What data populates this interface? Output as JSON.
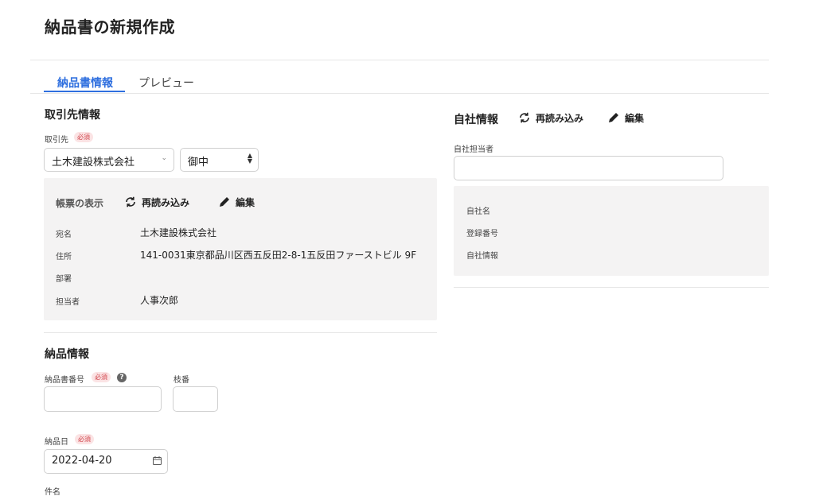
{
  "page": {
    "title": "納品書の新規作成"
  },
  "tabs": [
    {
      "label": "納品書情報",
      "active": true
    },
    {
      "label": "プレビュー",
      "active": false
    }
  ],
  "client": {
    "section_title": "取引先情報",
    "label": "取引先",
    "required": "必須",
    "selected": "土木建設株式会社",
    "honorific": "御中"
  },
  "display": {
    "title": "帳票の表示",
    "reload_label": "再読み込み",
    "edit_label": "編集",
    "rows": [
      {
        "label": "宛名",
        "value": "土木建設株式会社"
      },
      {
        "label": "住所",
        "value": "141-0031東京都品川区西五反田2-8-1五反田ファーストビル 9F"
      },
      {
        "label": "部署",
        "value": ""
      },
      {
        "label": "担当者",
        "value": "人事次郎"
      }
    ]
  },
  "company": {
    "section_title": "自社情報",
    "reload_label": "再読み込み",
    "edit_label": "編集",
    "person_label": "自社担当者",
    "person_value": "",
    "rows": [
      {
        "label": "自社名",
        "value": ""
      },
      {
        "label": "登録番号",
        "value": ""
      },
      {
        "label": "自社情報",
        "value": ""
      }
    ]
  },
  "delivery": {
    "section_title": "納品情報",
    "number_label": "納品書番号",
    "required": "必須",
    "help": "?",
    "branch_label": "枝番",
    "number_value": "",
    "branch_value": "",
    "date_label": "納品日",
    "date_value": "2022-04-20",
    "subject_label": "件名"
  },
  "colors": {
    "accent": "#2f6fdf",
    "required": "#d0434a",
    "panel": "#f4f3f3"
  }
}
